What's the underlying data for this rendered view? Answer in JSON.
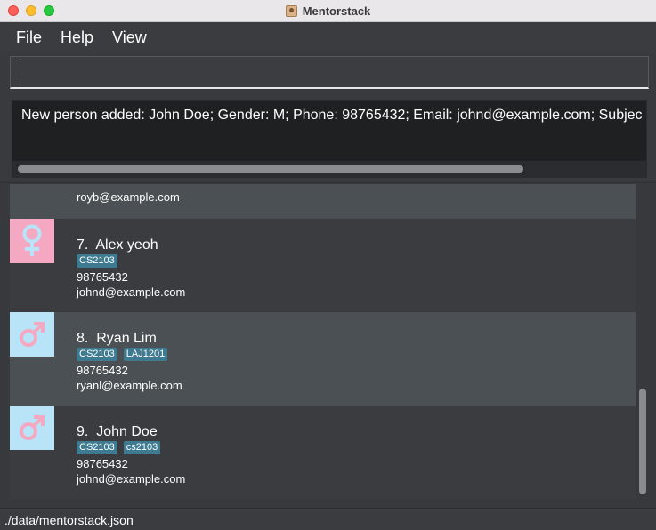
{
  "window": {
    "title": "Mentorstack"
  },
  "menu": {
    "items": [
      "File",
      "Help",
      "View"
    ]
  },
  "command": {
    "value": "",
    "placeholder": ""
  },
  "result": {
    "text": "New person added: John Doe; Gender: M; Phone: 98765432; Email: johnd@example.com; Subjec"
  },
  "list": {
    "partial_email": "royb@example.com",
    "persons": [
      {
        "index": "7.",
        "name": "Alex yeoh",
        "gender": "female",
        "tags": [
          "CS2103"
        ],
        "phone": "98765432",
        "email": "johnd@example.com"
      },
      {
        "index": "8.",
        "name": "Ryan Lim",
        "gender": "male",
        "tags": [
          "CS2103",
          "LAJ1201"
        ],
        "phone": "98765432",
        "email": "ryanl@example.com"
      },
      {
        "index": "9.",
        "name": "John Doe",
        "gender": "male",
        "tags": [
          "CS2103",
          "cs2103"
        ],
        "phone": "98765432",
        "email": "johnd@example.com"
      }
    ]
  },
  "status": {
    "path": "./data/mentorstack.json"
  },
  "colors": {
    "female_bg": "#f5a8c2",
    "male_bg": "#b9e3f6",
    "tag_bg": "#3e7b91",
    "female_symbol": "#b9e3f6",
    "male_symbol": "#f5a8c2"
  }
}
